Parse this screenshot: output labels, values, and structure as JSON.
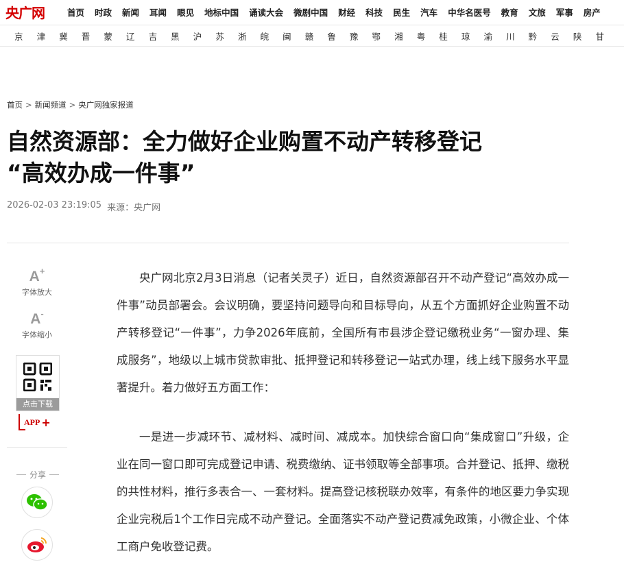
{
  "brand": {
    "logo_text": "央广网",
    "accent": "#d40000"
  },
  "nav": {
    "items": [
      "首页",
      "时政",
      "新闻",
      "耳闻",
      "眼见",
      "地标中国",
      "诵读大会",
      "微剧中国",
      "财经",
      "科技",
      "民生",
      "汽车",
      "中华名医号",
      "教育",
      "文旅",
      "军事",
      "房产"
    ]
  },
  "provinces": [
    "京",
    "津",
    "冀",
    "晋",
    "蒙",
    "辽",
    "吉",
    "黑",
    "沪",
    "苏",
    "浙",
    "皖",
    "闽",
    "赣",
    "鲁",
    "豫",
    "鄂",
    "湘",
    "粤",
    "桂",
    "琼",
    "渝",
    "川",
    "黔",
    "云",
    "陕",
    "甘"
  ],
  "breadcrumb": {
    "home": "首页",
    "channel": "新闻频道",
    "section": "央广网独家报道",
    "sep": ">"
  },
  "article": {
    "title_line1": "自然资源部：全力做好企业购置不动产转移登记",
    "title_line2": "“高效办成一件事”",
    "datetime": "2026-02-03 23:19:05",
    "source": "来源：央广网",
    "paragraphs": [
      "央广网北京2月3日消息（记者关灵子）近日，自然资源部召开不动产登记“高效办成一件事”动员部署会。会议明确，要坚持问题导向和目标导向，从五个方面抓好企业购置不动产转移登记“一件事”，力争2026年底前，全国所有市县涉企登记缴税业务“一窗办理、集成服务”，地级以上城市贷款审批、抵押登记和转移登记一站式办理，线上线下服务水平显著提升。着力做好五方面工作：",
      "一是进一步减环节、减材料、减时间、减成本。加快综合窗口向“集成窗口”升级，企业在同一窗口即可完成登记申请、税费缴纳、证书领取等全部事项。合并登记、抵押、缴税的共性材料，推行多表合一、一套材料。提高登记核税联办效率，有条件的地区要力争实现企业完税后1个工作日完成不动产登记。全面落实不动产登记费减免政策，小微企业、个体工商户免收登记费。"
    ]
  },
  "sidebar": {
    "font_up_symbol": "A",
    "font_up_sup": "+",
    "font_up_label": "字体放大",
    "font_down_symbol": "A",
    "font_down_sup": "-",
    "font_down_label": "字体缩小",
    "download_label": "点击下载",
    "app_label": "APP",
    "app_plus": "+",
    "share_label": "分享",
    "share_icons": [
      "wechat-icon",
      "weibo-icon"
    ]
  }
}
